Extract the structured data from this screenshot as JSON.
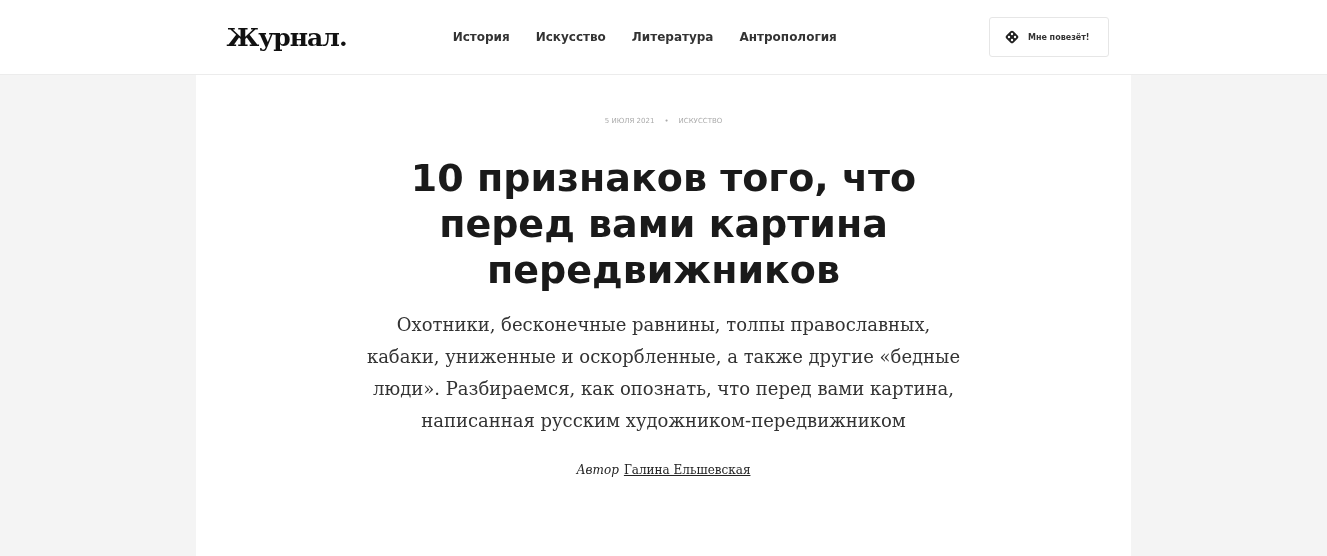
{
  "header": {
    "logo": "Журнал.",
    "nav": [
      {
        "label": "История"
      },
      {
        "label": "Искусство"
      },
      {
        "label": "Литература"
      },
      {
        "label": "Антропология"
      }
    ],
    "lucky_button": "Мне повезёт!"
  },
  "article": {
    "date": "5 ИЮЛЯ 2021",
    "separator": "•",
    "category": "ИСКУССТВО",
    "title": "10 признаков того, что перед вами картина передвижников",
    "lede": "Охотники, бесконечные равнины, толпы православных, кабаки, униженные и оскорбленные, а также другие «бедные люди». Разбираемся, как опознать, что перед вами картина, написанная русским художником-передвижником",
    "author_label": "Автор",
    "author": "Галина Ельшевская"
  }
}
